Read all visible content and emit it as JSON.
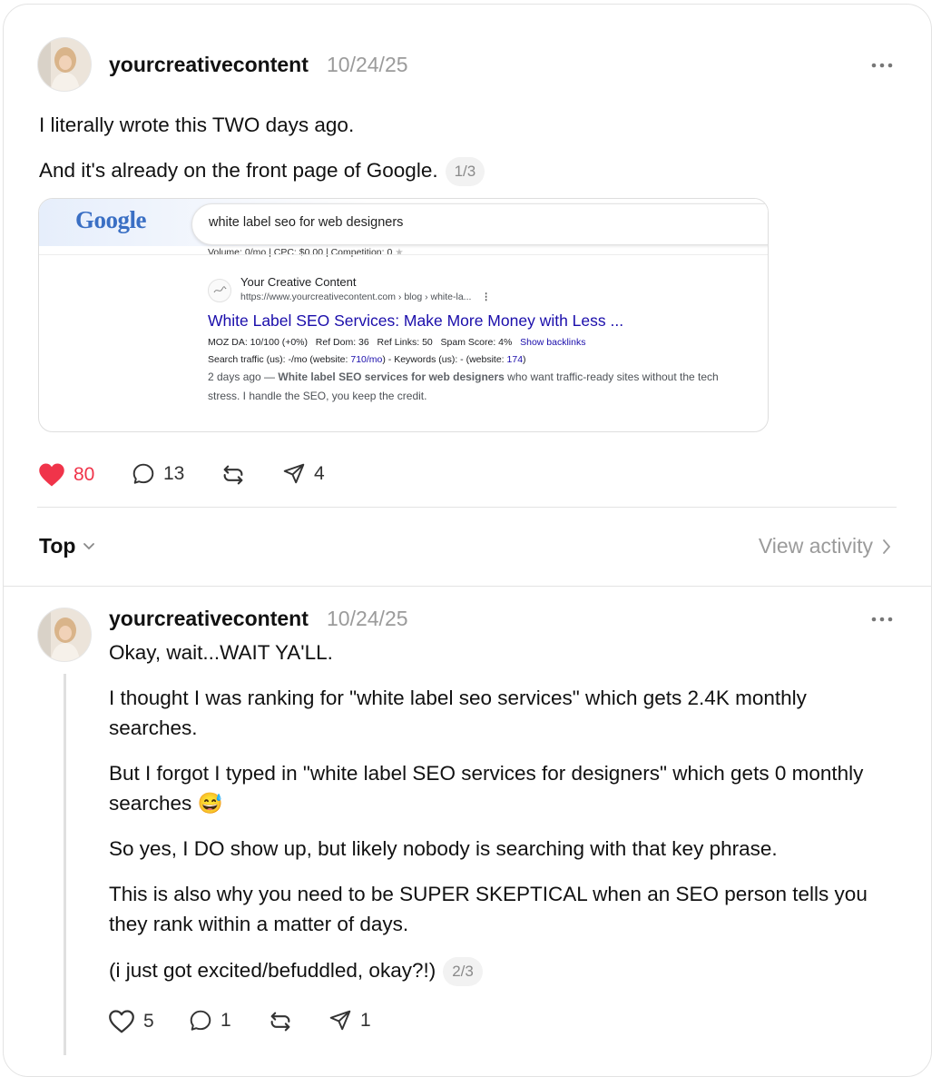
{
  "post": {
    "username": "yourcreativecontent",
    "date": "10/24/25",
    "paragraphs": [
      "I literally wrote this TWO days ago.",
      "And it's already on the front page of Google."
    ],
    "pager": "1/3",
    "screenshot": {
      "logo": "Google",
      "query": "white label seo for web designers",
      "volume_line": "Volume: 0/mo | CPC: $0.00 | Competition: 0",
      "site_name": "Your Creative Content",
      "site_url": "https://www.yourcreativecontent.com › blog › white-la...",
      "result_title": "White Label SEO Services: Make More Money with Less ...",
      "moz_da": "MOZ DA: 10/100 (+0%)",
      "ref_dom": "Ref Dom: 36",
      "ref_links": "Ref Links: 50",
      "spam_score": "Spam Score: 4%",
      "show_backlinks": "Show backlinks",
      "traffic_prefix": "Search traffic (us): -/mo (website: ",
      "traffic_site": "710/mo",
      "traffic_mid": ") - Keywords (us): - (website: ",
      "traffic_keywords": "174",
      "traffic_suffix": ")",
      "desc_age": "2 days ago — ",
      "desc_bold": "White label SEO services for web designers",
      "desc_rest": " who want traffic-ready sites without the tech stress. I handle the SEO, you keep the credit."
    },
    "actions": {
      "likes": "80",
      "comments": "13",
      "shares": "4"
    }
  },
  "sort": {
    "label": "Top",
    "view_activity": "View activity"
  },
  "reply": {
    "username": "yourcreativecontent",
    "date": "10/24/25",
    "first_line": "Okay, wait...WAIT YA'LL.",
    "paragraphs": [
      "I thought I was ranking for \"white label seo services\" which gets 2.4K monthly searches.",
      "But I forgot I typed in \"white label SEO services for designers\" which gets 0 monthly searches 😅",
      "So yes, I DO show up, but likely nobody is searching with that key phrase.",
      "This is also why you need to be SUPER SKEPTICAL when an SEO person tells you they rank within a matter of days.",
      "(i just got excited/befuddled, okay?!)"
    ],
    "pager": "2/3",
    "actions": {
      "likes": "5",
      "comments": "1",
      "shares": "1"
    }
  },
  "colors": {
    "heart": "#f0344a",
    "muted": "#9b9b9b",
    "link": "#1a0dab"
  }
}
